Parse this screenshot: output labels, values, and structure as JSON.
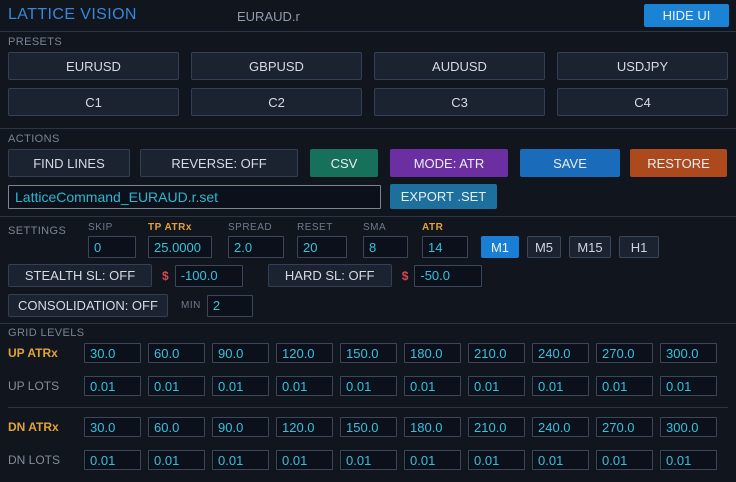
{
  "header": {
    "title": "LATTICE VISION",
    "symbol": "EURAUD.r",
    "hide_ui_label": "HIDE UI"
  },
  "presets": {
    "section_label": "PRESETS",
    "row1": [
      "EURUSD",
      "GBPUSD",
      "AUDUSD",
      "USDJPY"
    ],
    "row2": [
      "C1",
      "C2",
      "C3",
      "C4"
    ]
  },
  "actions": {
    "section_label": "ACTIONS",
    "find_lines_label": "FIND LINES",
    "reverse_label": "REVERSE: OFF",
    "csv_label": "CSV",
    "mode_label": "MODE: ATR",
    "save_label": "SAVE",
    "restore_label": "RESTORE",
    "filename_value": "LatticeCommand_EURAUD.r.set",
    "export_set_label": "EXPORT .SET"
  },
  "settings": {
    "section_label": "SETTINGS",
    "fields": [
      {
        "label": "SKIP",
        "value": "0",
        "highlight": false
      },
      {
        "label": "TP ATRx",
        "value": "25.0000",
        "highlight": true
      },
      {
        "label": "SPREAD",
        "value": "2.0",
        "highlight": false
      },
      {
        "label": "RESET",
        "value": "20",
        "highlight": false
      },
      {
        "label": "SMA",
        "value": "8",
        "highlight": false
      },
      {
        "label": "ATR",
        "value": "14",
        "highlight": true
      }
    ],
    "timeframes": [
      {
        "label": "M1",
        "active": true
      },
      {
        "label": "M5",
        "active": false
      },
      {
        "label": "M15",
        "active": false
      },
      {
        "label": "H1",
        "active": false
      }
    ],
    "stealth_sl": {
      "label": "STEALTH SL: OFF",
      "currency": "$",
      "value": "-100.0"
    },
    "hard_sl": {
      "label": "HARD SL: OFF",
      "currency": "$",
      "value": "-50.0"
    },
    "consolidation": {
      "label": "CONSOLIDATION: OFF",
      "min_label": "MIN",
      "min_value": "2"
    }
  },
  "grid_levels": {
    "section_label": "GRID LEVELS",
    "up_rows": [
      {
        "label": "UP ATRx",
        "highlight": true,
        "values": [
          "30.0",
          "60.0",
          "90.0",
          "120.0",
          "150.0",
          "180.0",
          "210.0",
          "240.0",
          "270.0",
          "300.0"
        ]
      },
      {
        "label": "UP LOTS",
        "highlight": false,
        "values": [
          "0.01",
          "0.01",
          "0.01",
          "0.01",
          "0.01",
          "0.01",
          "0.01",
          "0.01",
          "0.01",
          "0.01"
        ]
      }
    ],
    "dn_rows": [
      {
        "label": "DN ATRx",
        "highlight": true,
        "values": [
          "30.0",
          "60.0",
          "90.0",
          "120.0",
          "150.0",
          "180.0",
          "210.0",
          "240.0",
          "270.0",
          "300.0"
        ]
      },
      {
        "label": "DN LOTS",
        "highlight": false,
        "values": [
          "0.01",
          "0.01",
          "0.01",
          "0.01",
          "0.01",
          "0.01",
          "0.01",
          "0.01",
          "0.01",
          "0.01"
        ]
      }
    ]
  },
  "colors": {
    "background": "#10151e",
    "accent_blue": "#1a83d6",
    "timeframe_active_blue": "#1a7fd4",
    "csv_green": "#17705a",
    "mode_purple": "#6c2fa2",
    "save_blue": "#1a6cba",
    "restore_orange": "#ac4a1d",
    "export_blue": "#1d6f9e",
    "value_cyan": "#36c2de",
    "filename_cyan": "#29b9d3",
    "label_orange": "#e2a23b",
    "dollar_red": "#dd4455",
    "title_blue": "#3a86d8"
  }
}
